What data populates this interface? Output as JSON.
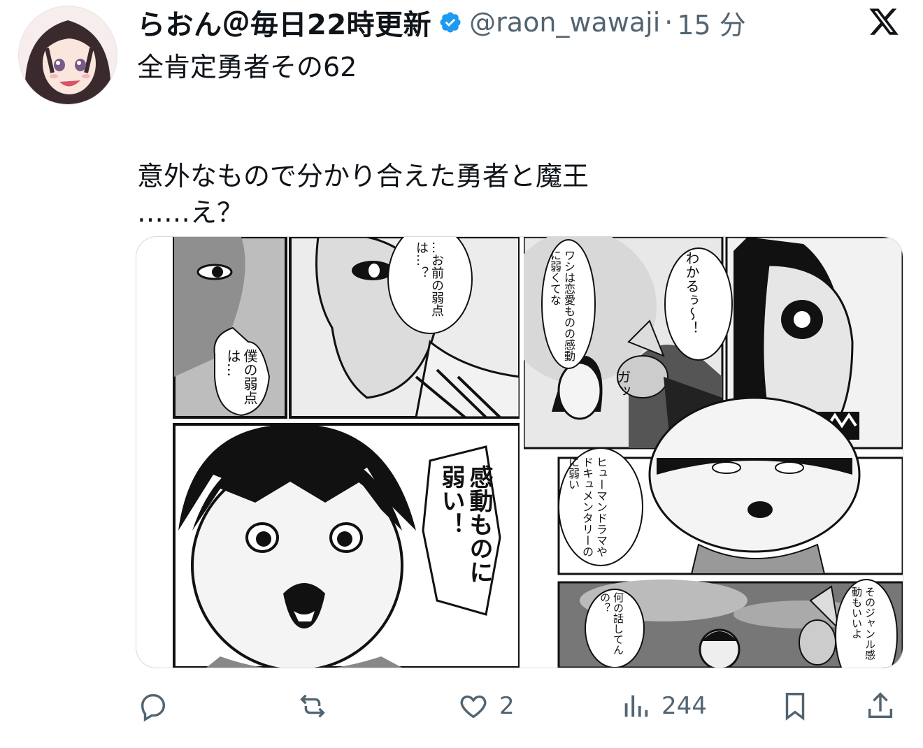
{
  "author": {
    "display_name": "らおん＠毎日22時更新",
    "handle": "@raon_wawaji",
    "separator": "·",
    "time": "15 分",
    "verified_color": "#1d9bf0"
  },
  "tweet": {
    "line1": "全肯定勇者その62",
    "line2": "意外なもので分かり合えた勇者と魔王",
    "line3": "……え？"
  },
  "manga": {
    "p1_bubble": "僕の弱点は…",
    "p2_bubble": "…お前の弱点は…？",
    "p3_bubble": "感動ものに弱い！",
    "p4_bubble_a": "ワシは恋愛ものの感動に弱くてな",
    "p4_bubble_b": "わかるぅ〜！",
    "p4_sfx": "ガッ",
    "p6_bubble": "ヒューマンドラマやドキュメンタリーのに弱い",
    "p7_bubble_a": "何の話してんの？",
    "p7_bubble_b": "そのジャンル感動もいいよ"
  },
  "actions": {
    "reply_icon": "reply-icon",
    "retweet_icon": "retweet-icon",
    "like_icon": "heart-icon",
    "like_count": "2",
    "views_icon": "views-chart-icon",
    "views_count": "244",
    "bookmark_icon": "bookmark-icon",
    "share_icon": "share-icon",
    "icon_color": "#536471"
  }
}
